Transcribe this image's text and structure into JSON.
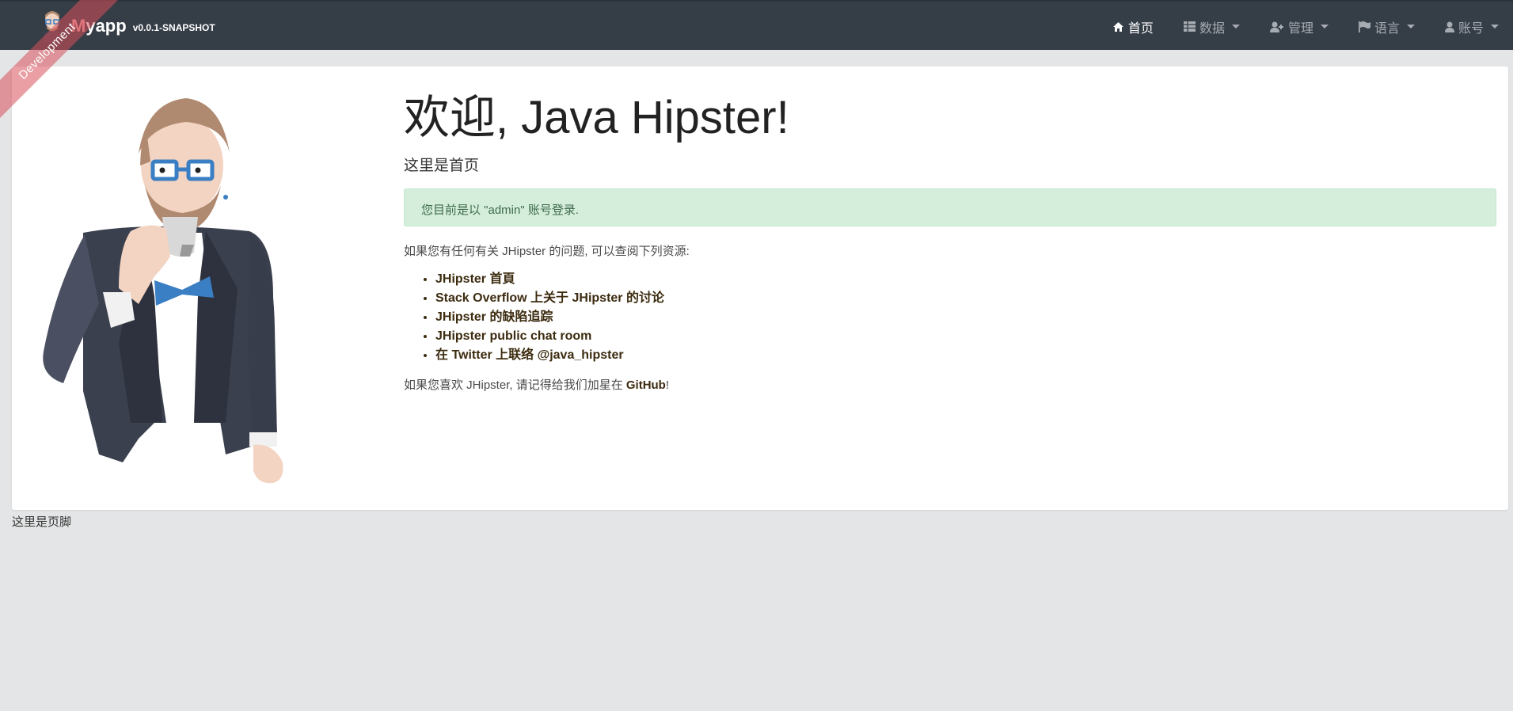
{
  "brand": {
    "m": "M",
    "rest": "yapp",
    "version": "v0.0.1-SNAPSHOT",
    "ribbon": "Development"
  },
  "nav": [
    {
      "label": "首页",
      "icon": "home-icon",
      "active": true
    },
    {
      "label": "数据",
      "icon": "table-icon"
    },
    {
      "label": "管理",
      "icon": "user-plus-icon"
    },
    {
      "label": "语言",
      "icon": "flag-icon"
    },
    {
      "label": "账号",
      "icon": "user-icon"
    }
  ],
  "main": {
    "title": "欢迎, Java Hipster!",
    "subtitle": "这里是首页",
    "alert": "您目前是以 \"admin\" 账号登录.",
    "intro": "如果您有任何有关 JHipster 的问题, 可以查阅下列资源:",
    "links": [
      "JHipster 首頁",
      "Stack Overflow 上关于 JHipster 的讨论",
      "JHipster 的缺陷追踪",
      "JHipster public chat room",
      "在 Twitter 上联络 @java_hipster"
    ],
    "github_prefix": "如果您喜欢 JHipster, 请记得给我们加星在 ",
    "github_link": "GitHub",
    "github_suffix": "!"
  },
  "footer": {
    "text": "这里是页脚"
  },
  "colors": {
    "navbar": "#353d47",
    "background": "#e4e5e6",
    "alert_bg": "#d5eedc",
    "link": "#3c2b0f"
  }
}
